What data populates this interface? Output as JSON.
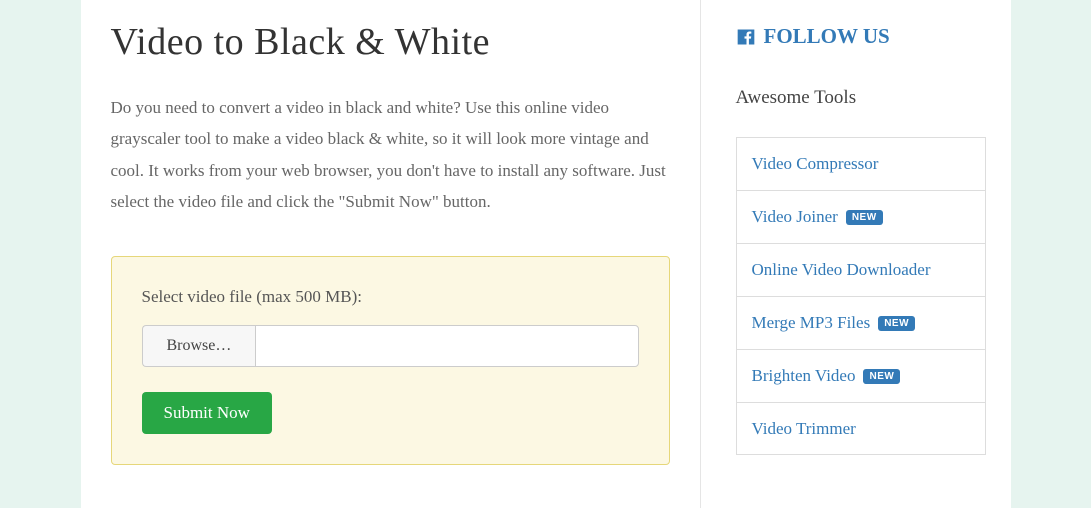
{
  "main": {
    "title": "Video to Black & White",
    "description": "Do you need to convert a video in black and white? Use this online video grayscaler tool to make a video black & white, so it will look more vintage and cool. It works from your web browser, you don't have to install any software. Just select the video file and click the \"Submit Now\" button.",
    "upload": {
      "label": "Select video file (max 500 MB):",
      "browse": "Browse…",
      "submit": "Submit Now"
    }
  },
  "sidebar": {
    "follow": "FOLLOW US",
    "awesome_title": "Awesome Tools",
    "new_badge": "NEW",
    "tools": [
      {
        "label": "Video Compressor",
        "new": false
      },
      {
        "label": "Video Joiner",
        "new": true
      },
      {
        "label": "Online Video Downloader",
        "new": false
      },
      {
        "label": "Merge MP3 Files",
        "new": true
      },
      {
        "label": "Brighten Video",
        "new": true
      },
      {
        "label": "Video Trimmer",
        "new": false
      }
    ]
  }
}
